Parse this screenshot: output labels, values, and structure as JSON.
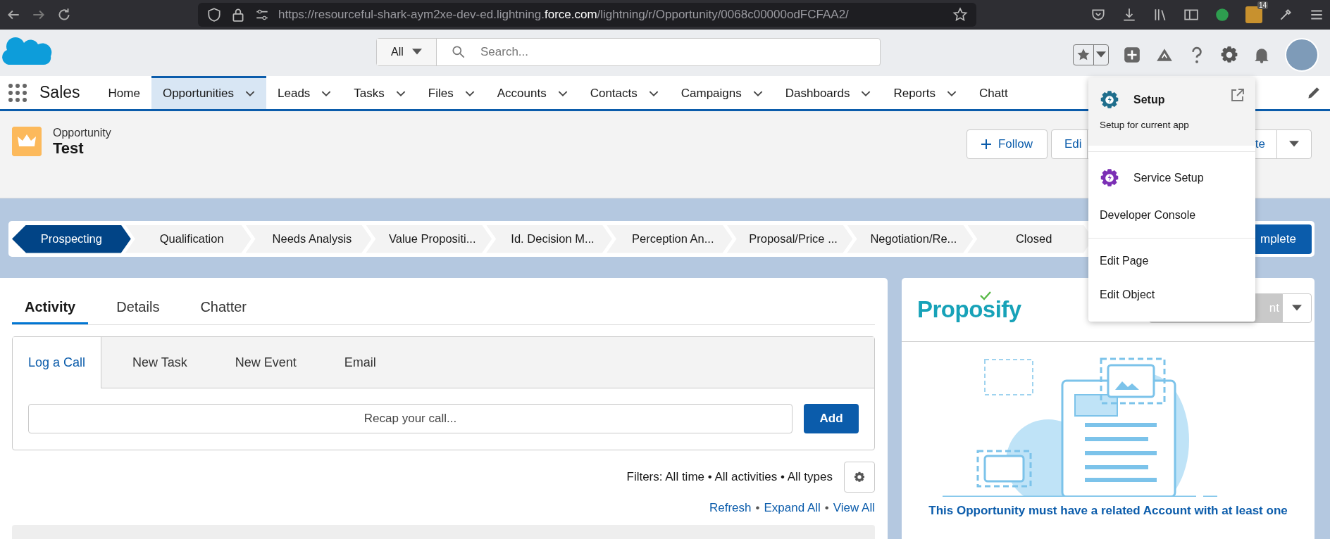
{
  "browser": {
    "url": "https://resourceful-shark-aym2xe-dev-ed.lightning.**force.com**/lightning/r/Opportunity/0068c00000odFCFAA2/",
    "extension_badge": "14"
  },
  "header": {
    "search_scope": "All",
    "search_placeholder": "Search..."
  },
  "nav": {
    "app_name": "Sales",
    "items": [
      {
        "label": "Home",
        "dropdown": false,
        "selected": false
      },
      {
        "label": "Opportunities",
        "dropdown": true,
        "selected": true
      },
      {
        "label": "Leads",
        "dropdown": true,
        "selected": false
      },
      {
        "label": "Tasks",
        "dropdown": true,
        "selected": false
      },
      {
        "label": "Files",
        "dropdown": true,
        "selected": false
      },
      {
        "label": "Accounts",
        "dropdown": true,
        "selected": false
      },
      {
        "label": "Contacts",
        "dropdown": true,
        "selected": false
      },
      {
        "label": "Campaigns",
        "dropdown": true,
        "selected": false
      },
      {
        "label": "Dashboards",
        "dropdown": true,
        "selected": false
      },
      {
        "label": "Reports",
        "dropdown": true,
        "selected": false
      },
      {
        "label": "Chatt",
        "dropdown": false,
        "selected": false
      }
    ]
  },
  "record": {
    "object_type": "Opportunity",
    "name": "Test",
    "buttons": [
      {
        "kind": "follow",
        "label": "Follow"
      },
      {
        "kind": "plain",
        "label": "Edi"
      },
      {
        "kind": "plain",
        "label": "te"
      },
      {
        "kind": "menu"
      }
    ]
  },
  "path": {
    "stages": [
      {
        "label": "Prospecting",
        "selected": true
      },
      {
        "label": "Qualification",
        "selected": false
      },
      {
        "label": "Needs Analysis",
        "selected": false
      },
      {
        "label": "Value Propositi...",
        "selected": false
      },
      {
        "label": "Id. Decision M...",
        "selected": false
      },
      {
        "label": "Perception An...",
        "selected": false
      },
      {
        "label": "Proposal/Price ...",
        "selected": false
      },
      {
        "label": "Negotiation/Re...",
        "selected": false
      },
      {
        "label": "Closed",
        "selected": false
      }
    ],
    "action": "mplete"
  },
  "activity": {
    "tabs": [
      {
        "label": "Activity",
        "selected": true
      },
      {
        "label": "Details",
        "selected": false
      },
      {
        "label": "Chatter",
        "selected": false
      }
    ],
    "composer_tabs": [
      {
        "label": "Log a Call",
        "selected": true
      },
      {
        "label": "New Task",
        "selected": false
      },
      {
        "label": "New Event",
        "selected": false
      },
      {
        "label": "Email",
        "selected": false
      }
    ],
    "placeholder": "Recap your call...",
    "add_button": "Add",
    "filters": "Filters: All time • All activities • All types",
    "links": [
      "Refresh",
      "Expand All",
      "View All"
    ],
    "link_separator": "•"
  },
  "proposify": {
    "logo": "Proposify",
    "button": "nt",
    "message": "This Opportunity must have a related Account with at least one"
  },
  "setup_menu": {
    "groups": [
      {
        "items": [
          {
            "kind": "app",
            "label": "Setup",
            "description": "Setup for current app",
            "color": "#1f6e8c",
            "highlighted": true,
            "external": true
          }
        ]
      },
      {
        "items": [
          {
            "kind": "app",
            "label": "Service Setup",
            "color": "#7b2fb5",
            "highlighted": false,
            "external": false
          },
          {
            "kind": "link",
            "label": "Developer Console",
            "highlighted": false,
            "external": false
          }
        ]
      },
      {
        "items": [
          {
            "kind": "link",
            "label": "Edit Page",
            "highlighted": false,
            "external": false
          },
          {
            "kind": "link",
            "label": "Edit Object",
            "highlighted": false,
            "external": false
          }
        ]
      }
    ]
  }
}
